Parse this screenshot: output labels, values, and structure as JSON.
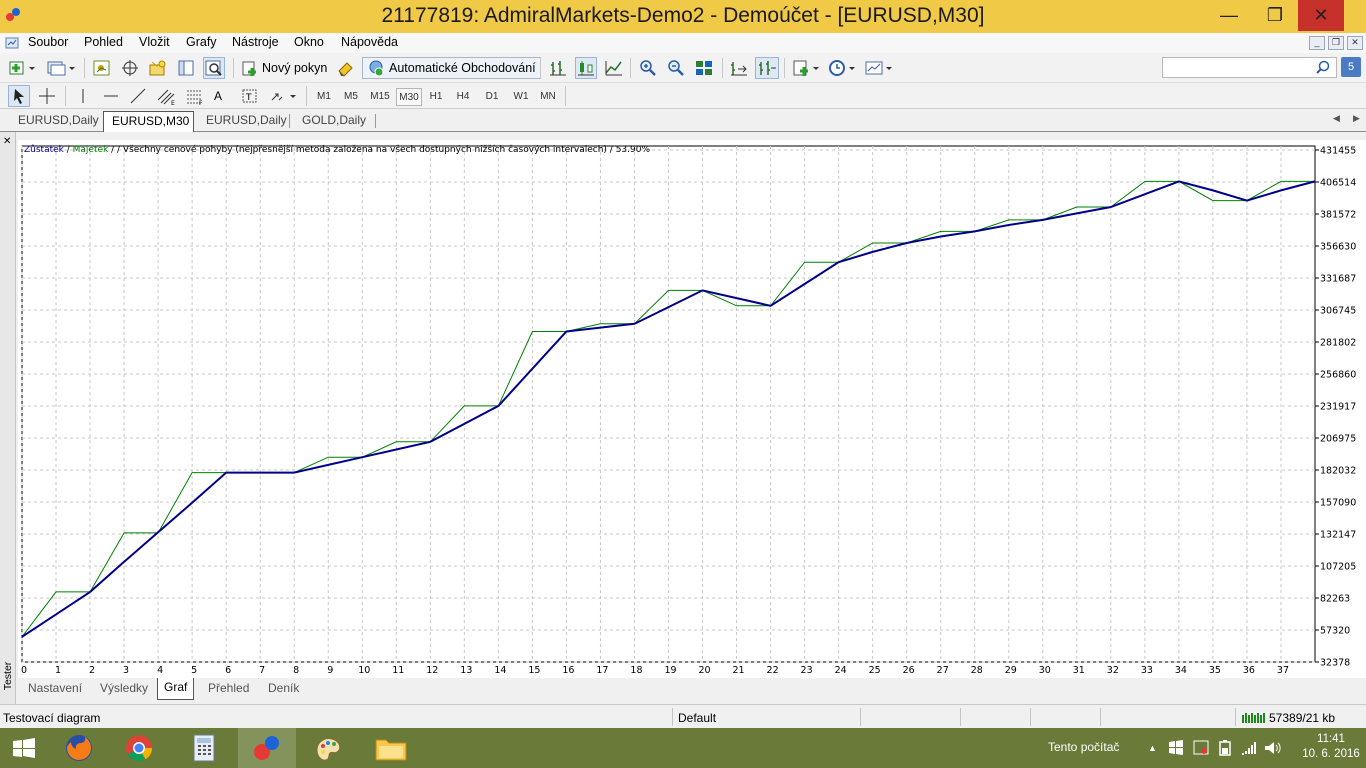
{
  "window": {
    "title": "21177819: AdmiralMarkets-Demo2 - Demoúčet - [EURUSD,M30]",
    "minimize": "—",
    "maximize": "❐",
    "close": "✕"
  },
  "menu": [
    "Soubor",
    "Pohled",
    "Vložit",
    "Grafy",
    "Nástroje",
    "Okno",
    "Nápověda"
  ],
  "toolbar": {
    "new_order": "Nový pokyn",
    "auto_trading": "Automatické Obchodování",
    "search_placeholder": ""
  },
  "timeframes": [
    "M1",
    "M5",
    "M15",
    "M30",
    "H1",
    "H4",
    "D1",
    "W1",
    "MN"
  ],
  "active_timeframe": "M30",
  "chart_tabs": [
    "EURUSD,Daily",
    "EURUSD,M30",
    "EURUSD,Daily",
    "GOLD,Daily"
  ],
  "active_chart_tab": 1,
  "legend": {
    "balance": "Zůstatek",
    "equity": "Majetek",
    "rest": "/ Všechny cenové pohyby (nejpřesnější metoda založena na všech dostupných nižších časových intervalech) / 53.90%",
    "sep": " / "
  },
  "tester": {
    "side_label": "Tester",
    "tabs": [
      "Nastavení",
      "Výsledky",
      "Graf",
      "Přehled",
      "Deník"
    ],
    "active_tab": 2
  },
  "status": {
    "text": "Testovací diagram",
    "profile": "Default",
    "traffic": "57389/21 kb"
  },
  "taskbar": {
    "tray_label": "Tento počítač",
    "time": "11:41",
    "date": "10. 6. 2016"
  },
  "colors": {
    "balance": "#00008b",
    "equity": "#008000",
    "titlebar": "#f0c946",
    "close": "#c7312b"
  },
  "chart_data": {
    "type": "line",
    "x": [
      0,
      1,
      2,
      3,
      4,
      5,
      6,
      7,
      8,
      9,
      10,
      11,
      12,
      13,
      14,
      15,
      16,
      17,
      18,
      19,
      20,
      21,
      22,
      23,
      24,
      25,
      26,
      27,
      28,
      29,
      30,
      31,
      32,
      33,
      34,
      35,
      36,
      37,
      38
    ],
    "x_ticks": [
      "0",
      "1",
      "2",
      "3",
      "4",
      "5",
      "6",
      "7",
      "8",
      "9",
      "10",
      "11",
      "12",
      "13",
      "14",
      "15",
      "16",
      "17",
      "18",
      "19",
      "20",
      "21",
      "22",
      "23",
      "24",
      "25",
      "26",
      "27",
      "28",
      "29",
      "30",
      "31",
      "32",
      "33",
      "34",
      "35",
      "36",
      "37"
    ],
    "y_ticks": [
      "431455",
      "406514",
      "381572",
      "356630",
      "331687",
      "306745",
      "281802",
      "256860",
      "231917",
      "206975",
      "182032",
      "157090",
      "132147",
      "107205",
      "82263",
      "57320",
      "32378"
    ],
    "ylim": [
      32378,
      431455
    ],
    "series": [
      {
        "name": "Zůstatek",
        "color": "#00008b",
        "values": [
          52000,
          69500,
          87000,
          110500,
          133500,
          156500,
          180000,
          180000,
          180000,
          186000,
          192000,
          198000,
          204000,
          218000,
          232000,
          261000,
          290000,
          293000,
          296000,
          309000,
          322000,
          316000,
          310000,
          327000,
          344000,
          352000,
          359000,
          364000,
          368000,
          373000,
          377000,
          382000,
          387000,
          397000,
          407000,
          400000,
          392000,
          400000,
          407000
        ]
      },
      {
        "name": "Majetek",
        "color": "#008000",
        "values": [
          52000,
          87000,
          87000,
          133000,
          133000,
          180000,
          180000,
          180000,
          180000,
          192000,
          192000,
          204000,
          204000,
          232000,
          232000,
          290000,
          290000,
          296000,
          296000,
          322000,
          322000,
          310000,
          310000,
          344000,
          344000,
          359000,
          359000,
          368000,
          368000,
          377000,
          377000,
          387000,
          387000,
          407000,
          407000,
          392000,
          392000,
          407000,
          407000
        ]
      }
    ]
  }
}
